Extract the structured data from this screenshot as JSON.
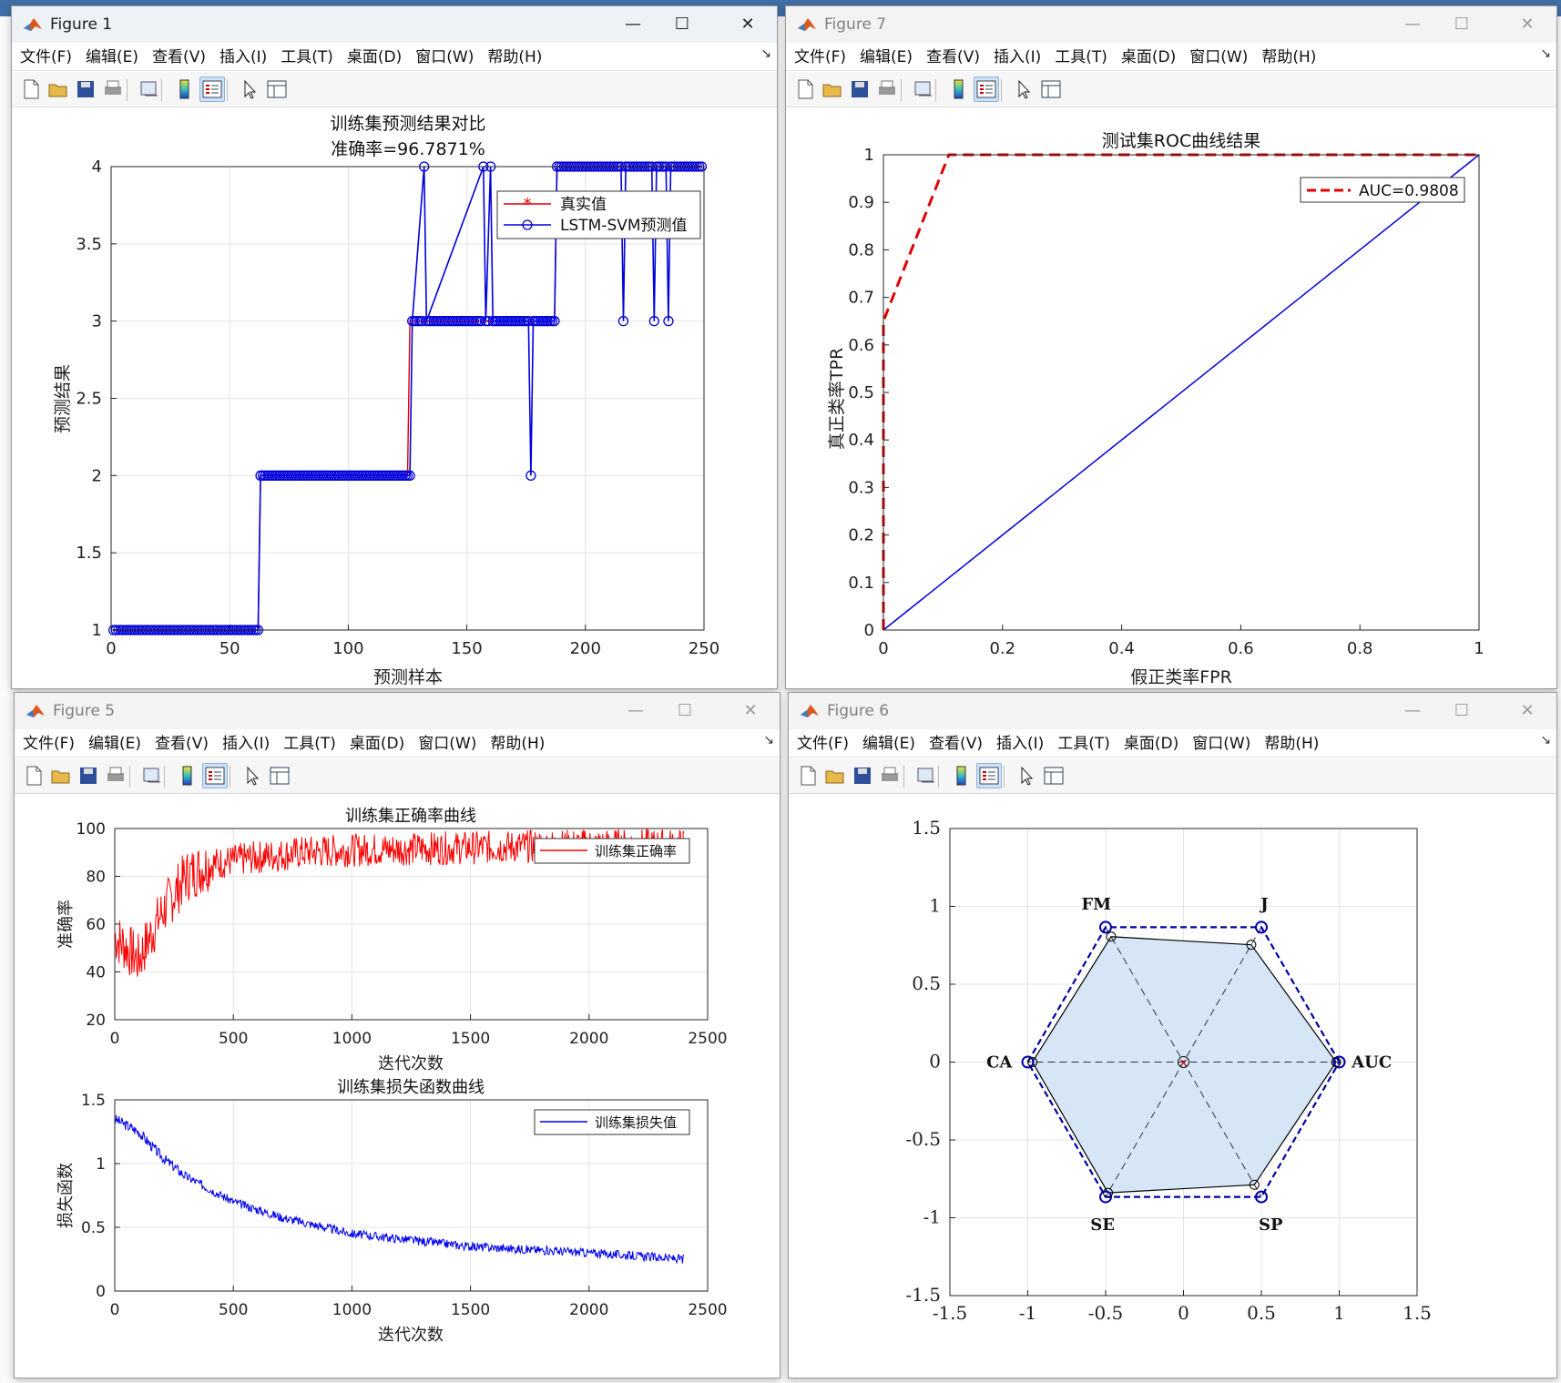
{
  "menu": [
    "文件(F)",
    "编辑(E)",
    "查看(V)",
    "插入(I)",
    "工具(T)",
    "桌面(D)",
    "窗口(W)",
    "帮助(H)"
  ],
  "colors": {
    "red": "#e00000",
    "blue": "#0000dd",
    "grid": "#e6e6e6",
    "fill": "#d6e6f7"
  },
  "fig1": {
    "title": "Figure 1",
    "chart_data": {
      "type": "line",
      "title": "训练集预测结果对比",
      "subtitle": "准确率=96.7871%",
      "xlabel": "预测样本",
      "ylabel": "预测结果",
      "xlim": [
        0,
        250
      ],
      "ylim": [
        1,
        4
      ],
      "xticks": [
        "0",
        "50",
        "100",
        "150",
        "200",
        "250"
      ],
      "yticks": [
        "1",
        "1.5",
        "2",
        "2.5",
        "3",
        "3.5",
        "4"
      ],
      "legend": [
        "真实值",
        "LSTM-SVM预测值"
      ],
      "legend_position": "top-right",
      "series": [
        {
          "name": "真实值",
          "x": [
            1,
            62,
            63,
            125,
            126,
            187,
            188,
            249
          ],
          "y": [
            1,
            1,
            2,
            2,
            3,
            3,
            4,
            4
          ]
        },
        {
          "name": "LSTM-SVM预测值",
          "x": [
            1,
            62,
            63,
            126,
            127,
            132,
            133,
            157,
            158,
            160,
            161,
            176,
            177,
            178,
            179,
            187,
            188,
            215,
            216,
            217,
            228,
            229,
            230,
            234,
            235,
            236,
            249
          ],
          "y": [
            1,
            1,
            2,
            2,
            3,
            4,
            3,
            4,
            3,
            4,
            3,
            3,
            2,
            3,
            3,
            3,
            4,
            4,
            3,
            4,
            4,
            3,
            4,
            4,
            3,
            4,
            4
          ]
        }
      ]
    }
  },
  "fig7": {
    "title": "Figure 7",
    "chart_data": {
      "type": "line",
      "title": "测试集ROC曲线结果",
      "xlabel": "假正类率FPR",
      "ylabel": "真正类率TPR",
      "xlim": [
        0,
        1
      ],
      "ylim": [
        0,
        1
      ],
      "xticks": [
        "0",
        "0.2",
        "0.4",
        "0.6",
        "0.8",
        "1"
      ],
      "yticks": [
        "0",
        "0.1",
        "0.2",
        "0.3",
        "0.4",
        "0.5",
        "0.6",
        "0.7",
        "0.8",
        "0.9",
        "1"
      ],
      "legend": [
        "AUC=0.9808"
      ],
      "legend_position": "top-right",
      "series": [
        {
          "name": "AUC=0.9808",
          "x": [
            0,
            0,
            0.11,
            1
          ],
          "y": [
            0,
            0.65,
            1,
            1
          ]
        },
        {
          "x": [
            0,
            1
          ],
          "y": [
            0,
            1
          ]
        }
      ]
    }
  },
  "fig5": {
    "title": "Figure 5",
    "chart_data": [
      {
        "type": "line",
        "title": "训练集正确率曲线",
        "xlabel": "迭代次数",
        "ylabel": "准确率",
        "xlim": [
          0,
          2500
        ],
        "ylim": [
          20,
          100
        ],
        "xticks": [
          "0",
          "500",
          "1000",
          "1500",
          "2000",
          "2500"
        ],
        "yticks": [
          "20",
          "40",
          "60",
          "80",
          "100"
        ],
        "legend": [
          "训练集正确率"
        ],
        "legend_position": "top-right",
        "series": [
          {
            "name": "训练集正确率",
            "x": [
              0,
              100,
              200,
              300,
              400,
              600,
              800,
              1000,
              1500,
              2000,
              2400
            ],
            "y": [
              55,
              45,
              65,
              80,
              85,
              88,
              90,
              91,
              92,
              93,
              93
            ]
          }
        ]
      },
      {
        "type": "line",
        "title": "训练集损失函数曲线",
        "xlabel": "迭代次数",
        "ylabel": "损失函数",
        "xlim": [
          0,
          2500
        ],
        "ylim": [
          0,
          1.5
        ],
        "xticks": [
          "0",
          "500",
          "1000",
          "1500",
          "2000",
          "2500"
        ],
        "yticks": [
          "0",
          "0.5",
          "1",
          "1.5"
        ],
        "legend": [
          "训练集损失值"
        ],
        "legend_position": "top-right",
        "series": [
          {
            "name": "训练集损失值",
            "x": [
              0,
              100,
              200,
              300,
              500,
              700,
              1000,
              1500,
              2000,
              2400
            ],
            "y": [
              1.35,
              1.25,
              1.05,
              0.9,
              0.7,
              0.58,
              0.45,
              0.35,
              0.3,
              0.25
            ]
          }
        ]
      }
    ]
  },
  "fig6": {
    "title": "Figure 6",
    "chart_data": {
      "type": "radar",
      "xlim": [
        -1.5,
        1.5
      ],
      "ylim": [
        -1.5,
        1.5
      ],
      "xticks": [
        "-1.5",
        "-1",
        "-0.5",
        "0",
        "0.5",
        "1",
        "1.5"
      ],
      "yticks": [
        "-1.5",
        "-1",
        "-0.5",
        "0",
        "0.5",
        "1",
        "1.5"
      ],
      "axes": [
        "AUC",
        "J",
        "FM",
        "CA",
        "SE",
        "SP"
      ],
      "values": [
        0.98,
        0.87,
        0.93,
        0.97,
        0.97,
        0.91
      ]
    }
  }
}
